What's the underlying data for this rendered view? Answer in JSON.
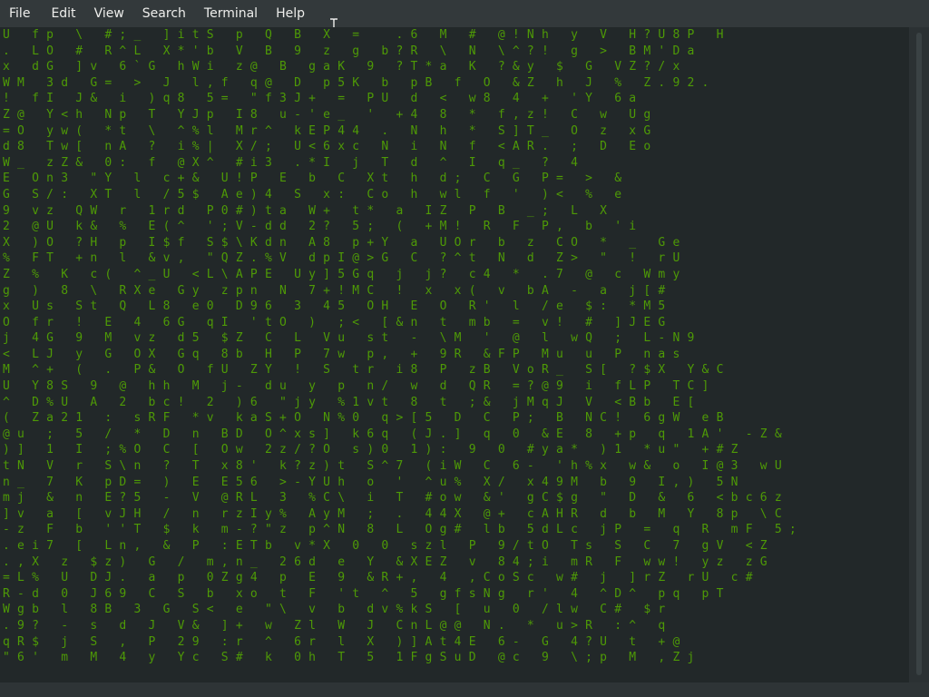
{
  "menubar": {
    "items": [
      {
        "label": "File"
      },
      {
        "label": "Edit"
      },
      {
        "label": "View"
      },
      {
        "label": "Search"
      },
      {
        "label": "Terminal"
      },
      {
        "label": "Help"
      }
    ]
  },
  "colors": {
    "terminal_bg": "#222829",
    "matrix_green": "#4e9a06",
    "highlight": "#e0e6d8",
    "chrome": "#33393b"
  },
  "icons": {
    "cursor": "text-cursor-icon"
  },
  "terminal": {
    "rows": [
      "U   f p   \\   # ; _   ] i t S   p   Q   B   X   =     . 6   M   #   @ ! N h   y   V   H ? U 8 P   H",
      ".   L O   #   R ^ L   X * ' b   V   B   9   z   g   b ? R   \\   N   \\ ^ ? !   g   >   B M ' D a",
      "x   d G   ] v   6 ` G   h W i   z @   B   g a K   9   ? T * a   K   ? & y   $   G   V Z ? / x",
      "W M   3 d   G =   >   J   l , f   q @   D   p 5 K   b   p B   f   O   & Z   h   J   %   Z . 9 2 .",
      "!   f I   J &   i   ) q 8   5 =   \" f 3 J +   =   P U   d   <   w 8   4   +   ' Y   6 a",
      "Z @   Y < h   N p   T   Y J p   I 8   u - ' e _   '   + 4   8   *   f , z !   C   w   U g",
      "= O   y w (   * t   \\   ^ % l   M r ^   k E P 4 4   .   N   h   *   S ] T _   O   z   x G",
      "d 8   T w [   n A   ?   i % |   X / ;   U < 6 x c   N   i   N   f   < A R .   ;   D   E o",
      "W _   z Z &   0 :   f   @ X ^   # i 3   . * I   j   T   d   ^   I   q _   ?   4",
      "E   O n 3   \" Y   l   c + &   U ! P   E   b   C   X t   h   d ;   C   G   P =   >   &",
      "G   S / :   X T   l   / 5 $   A e ) 4   S   x :   C o   h   w l   f   '   ) <   %   e",
      "9   v z   Q W   r   1 r d   P 0 # ) t a   W +   t *   a   I Z   P   B   _ ;   L   X",
      "2   @ U   k &   %   E ( ^   ' ; V - d d   2 ?   5 ;   (   + M !   R   F   P ,   b   ' i",
      "X   ) O   ? H   p   I $ f   S $ \\ K d n   A 8   p + Y   a   U O r   b   z   C O   *   _   G e",
      "%   F T   + n   l   & v ,   \" Q Z . % V   d p I @ > G   C   ? ^ t   N   d   Z >   \"   !   r U",
      "Z   %   K   c (   ^ _ U   < L \\ A P E   U y ] 5 G q   j   j ?   c 4   *   . 7   @   c   W m y",
      "g   )   8   \\   R X e   G y   z p n   N   7 + ! M C   !   x   x (   v   b A   -   a   j [ #",
      "x   U s   S t   Q   L 8   e 0   D 9 6   3   4 5   O H   E   O   R '   l   / e   $ :   * M 5",
      "O   f r   !   E   4   6 G   q I   ' t O   )   ; <   [ & n   t   m b   =   v !   #   ] J E G",
      "j   4 G   9   M   v z   d 5   $ Z   C   L   V u   s t   -   \\ M   '   @   l   w Q   ;   L - N 9",
      "<   L J   y   G   O X   G q   8 b   H   P   7 w   p ,   +   9 R   & F P   M u   u   P   n a s",
      "M   ^ +   (   .   P &   O   f U   Z Y   !   S   t r   i 8   P   z B   V o R _   S [   ? $ X   Y & C",
      "U   Y 8 S   9   @   h h   M   j -   d u   y   p   n /   w   d   Q R   = ? @ 9   i   f L P   T C ]",
      "^   D % U   A   2   b c !   2   ) 6   \" j y   % 1 v t   8   t   ; &   j M q J   V   < B b   E [",
      "(   Z a 2 1   :   s R F   * v   k a S + O   N % 0   q > [ 5   D   C   P ;   B   N C !   6 g W   e B",
      "@ u   ;   5   /   *   D   n   B D   O ^ x s ]   k 6 q   ( J . ]   q   0   & E   8   + p   q   1 A '   - Z &",
      ") ]   1   I   ; % O   C   [   O w   2 z / ? O   s ) 0   1 ) :   9   0   # y a *   ) 1   * u \"   + # Z",
      "t N   V   r   S \\ n   ?   T   x 8 '   k ? z ) t   S ^ 7   ( i W   C   6 -   ' h % x   w &   o   I @ 3   w U",
      "n _   7   K   p D =   )   E   E 5 6   > - Y U h   o   '   ^ u %   X /   x 4 9 M   b   9   I , )   5 N",
      "m j   &   n   E ? 5   -   V   @ R L   3   % C \\   i   T   # o w   & '   g C $ g   \"   D   &   6   < b c 6 z",
      "] v   a   [   v J H   /   n   r z I y %   A y M   ;   .   4 4 X   @ +   c A H R   d   b   M   Y   8 p   \\ C",
      "- z   F   b   ' ' T   $   k   m - ? \" z   p ^ N   8   L   O g #   l b   5 d L c   j P   =   q   R   m F   5 ;",
      ". e i 7   [   L n ,   &   P   : E T b   v * X   0   0   s z l   P   9 / t O   T s   S   C   7   g V   < Z",
      ". , X   z   $ z )   G   /   m , n _   2 6 d   e   Y   & X E Z   v   8 4 ; i   m R   F   w w !   y z   z G",
      "= L %   U   D J .   a   p   0 Z g 4   p   E   9   & R + ,   4   , C o S c   w #   j   ] r Z   r U   c #",
      "R - d   0   J 6 9   C   S   b   x o   t   F   ' t   ^   5   g f s N g   r '   4   ^ D ^   p q   p T",
      "W g b   l   8 B   3   G   S <   e   \" \\   v   b   d v % k S   [   u   0   / l w   C #   $ r",
      ". 9 ?   -   s   d   J   V &   ] +   w   Z l   W   J   C n L @ @   N .   *   u > R   : ^   q",
      "q R $   j   S   ,   P   2 9   : r   ^   6 r   l   X   ) ] A t 4 E   6 -   G   4 ? U   t   + @",
      "\" 6 '   m   M   4   y   Y c   S #   k   0 h   T   5   1 F g S u D   @ c   9   \\ ; p   M   , Z j"
    ]
  }
}
